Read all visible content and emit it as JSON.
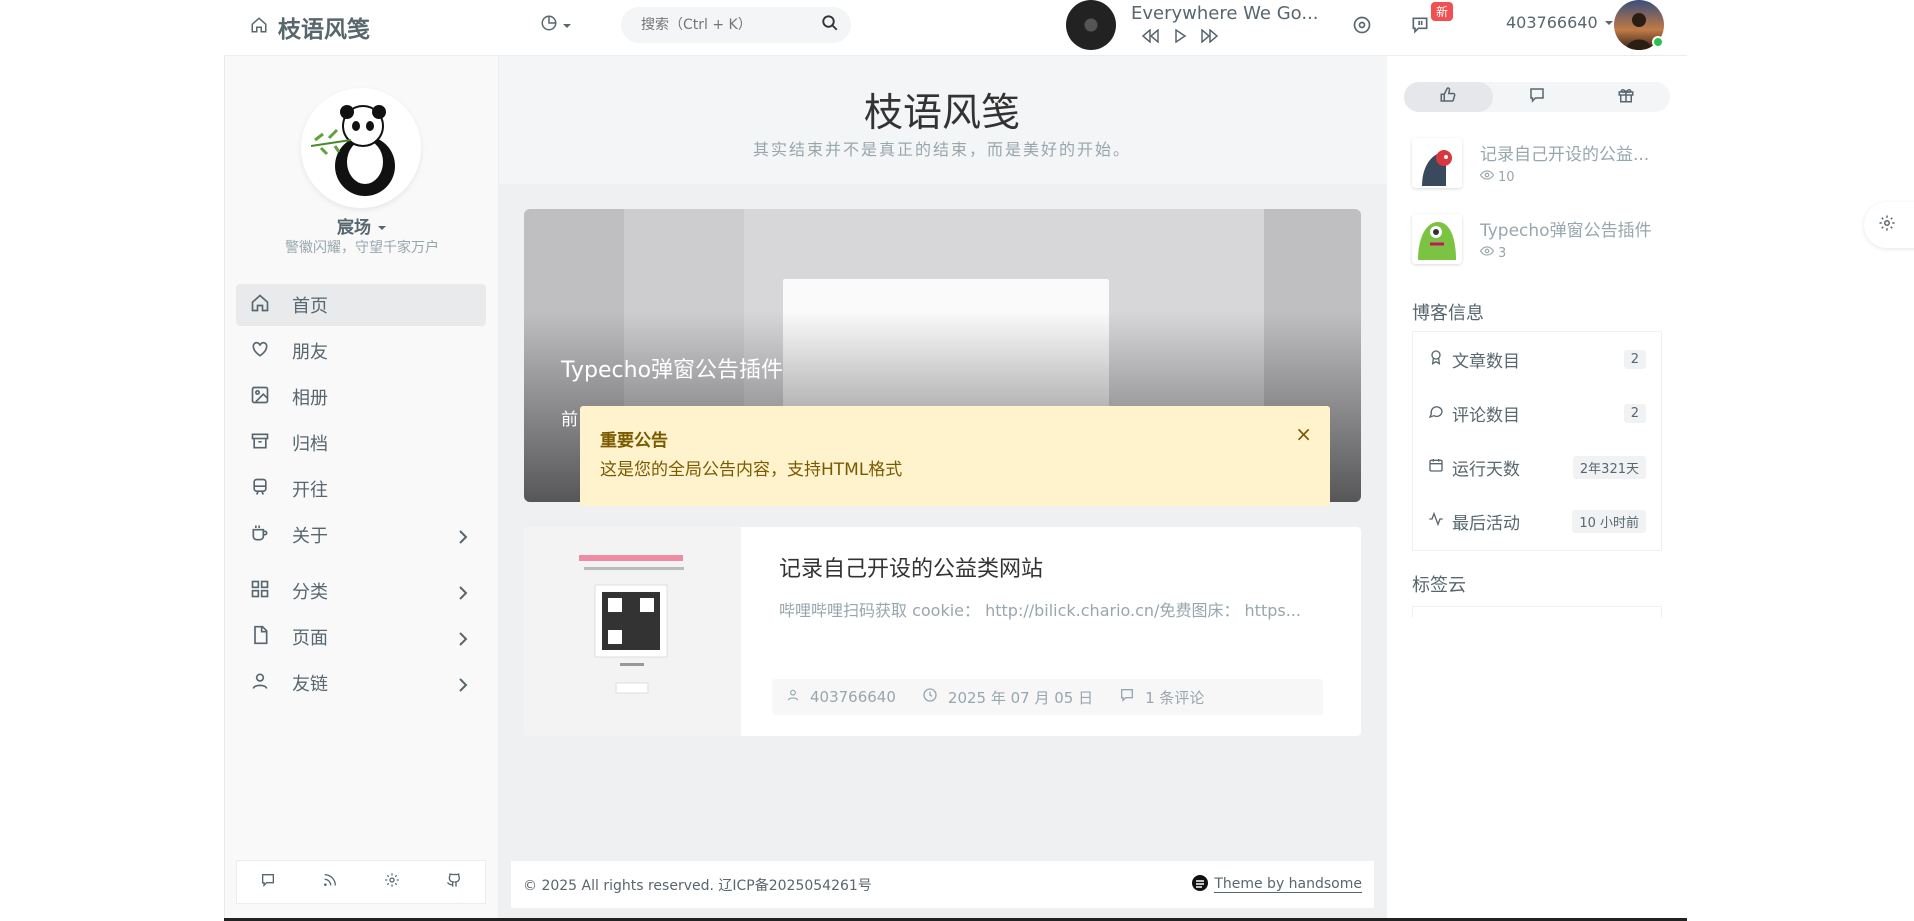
{
  "header": {
    "brand_title": "枝语风笺",
    "search_placeholder": "搜索（Ctrl + K）",
    "player_song": "Everywhere We Go...",
    "notification_badge": "新",
    "username": "403766640"
  },
  "profile": {
    "nickname": "宸场",
    "motto": "警徽闪耀，守望千家万户"
  },
  "nav": {
    "items": [
      {
        "label": "首页"
      },
      {
        "label": "朋友"
      },
      {
        "label": "相册"
      },
      {
        "label": "归档"
      },
      {
        "label": "开往"
      },
      {
        "label": "关于"
      },
      {
        "label": "分类"
      },
      {
        "label": "页面"
      },
      {
        "label": "友链"
      }
    ]
  },
  "site": {
    "title": "枝语风笺",
    "subtitle": "其实结束并不是真正的结束，而是美好的开始。"
  },
  "banner": {
    "title": "Typecho弹窗公告插件",
    "excerpt_start": "前"
  },
  "notice": {
    "title": "重要公告",
    "body": "这是您的全局公告内容，支持HTML格式",
    "close": "×"
  },
  "post": {
    "title": "记录自己开设的公益类网站",
    "excerpt": "哔哩哔哩扫码获取 cookie： http://bilick.chario.cn/免费图床： https...",
    "author": "403766640",
    "date": "2025 年 07 月 05 日",
    "comments": "1 条评论"
  },
  "footer": {
    "copyright": "© 2025 All rights reserved. 辽ICP备2025054261号",
    "theme": "Theme by handsome"
  },
  "sidebar_right": {
    "hot_posts": [
      {
        "title": "记录自己开设的公益...",
        "views": "10"
      },
      {
        "title": "Typecho弹窗公告插件",
        "views": "3"
      }
    ],
    "blog_info_title": "博客信息",
    "blog_info": [
      {
        "label": "文章数目",
        "value": "2"
      },
      {
        "label": "评论数目",
        "value": "2"
      },
      {
        "label": "运行天数",
        "value": "2年321天"
      },
      {
        "label": "最后活动",
        "value": "10 小时前"
      }
    ],
    "tag_cloud_title": "标签云"
  },
  "colors": {
    "notice_bg": "#fff3cd",
    "notice_text": "#7a5a00",
    "badge": "#f05050",
    "online": "#27c24c"
  }
}
